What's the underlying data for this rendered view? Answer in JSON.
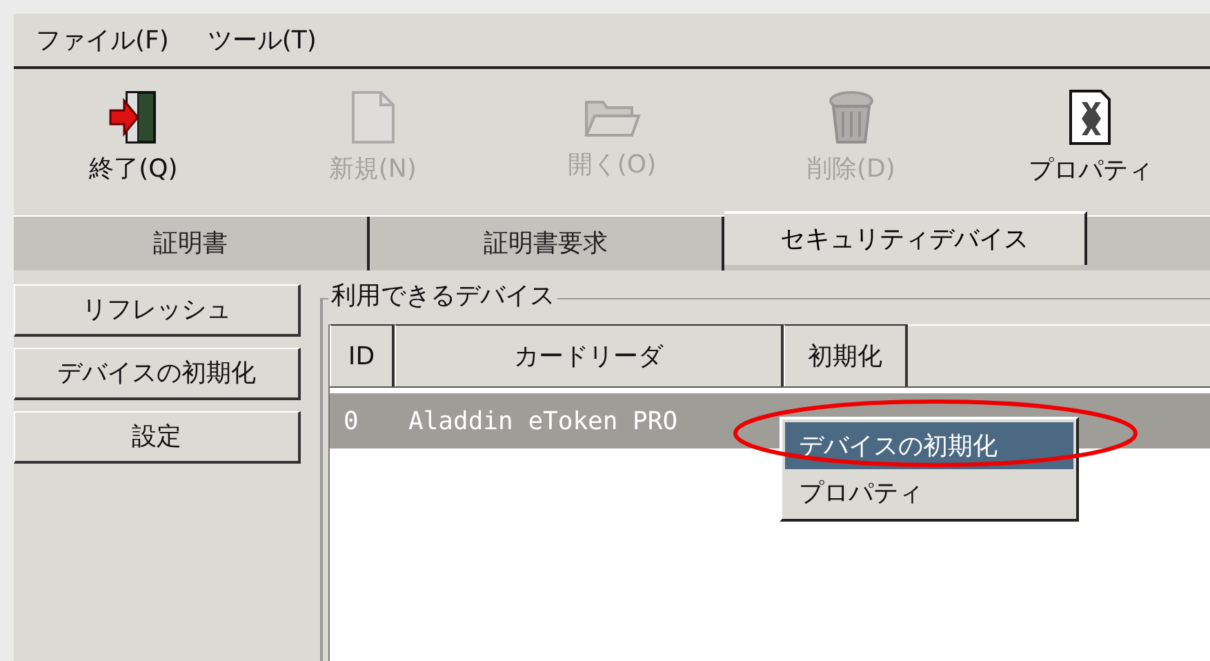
{
  "menu_bar": [
    {
      "label": "ファイル(F)"
    },
    {
      "label": "ツール(T)"
    }
  ],
  "toolbar": [
    {
      "kind": "exit",
      "label": "終了(Q)",
      "disabled": false
    },
    {
      "kind": "new",
      "label": "新規(N)",
      "disabled": true
    },
    {
      "kind": "open",
      "label": "開く(O)",
      "disabled": true
    },
    {
      "kind": "delete",
      "label": "削除(D)",
      "disabled": true
    },
    {
      "kind": "properties",
      "label": "プロパティ",
      "disabled": false
    }
  ],
  "tabs": [
    {
      "label": "証明書",
      "selected": false
    },
    {
      "label": "証明書要求",
      "selected": false
    },
    {
      "label": "セキュリティデバイス",
      "selected": true
    }
  ],
  "side_buttons": [
    "リフレッシュ",
    "デバイスの初期化",
    "設定"
  ],
  "group": {
    "title": "利用できるデバイス",
    "table": {
      "columns": [
        "ID",
        "カードリーダ",
        "初期化"
      ],
      "rows": [
        {
          "cells": [
            "0",
            "Aladdin eToken PRO"
          ],
          "selected": true
        }
      ]
    }
  },
  "context_menu": [
    {
      "label": "デバイスの初期化",
      "selected": true
    },
    {
      "label": "プロパティ",
      "selected": false
    }
  ]
}
